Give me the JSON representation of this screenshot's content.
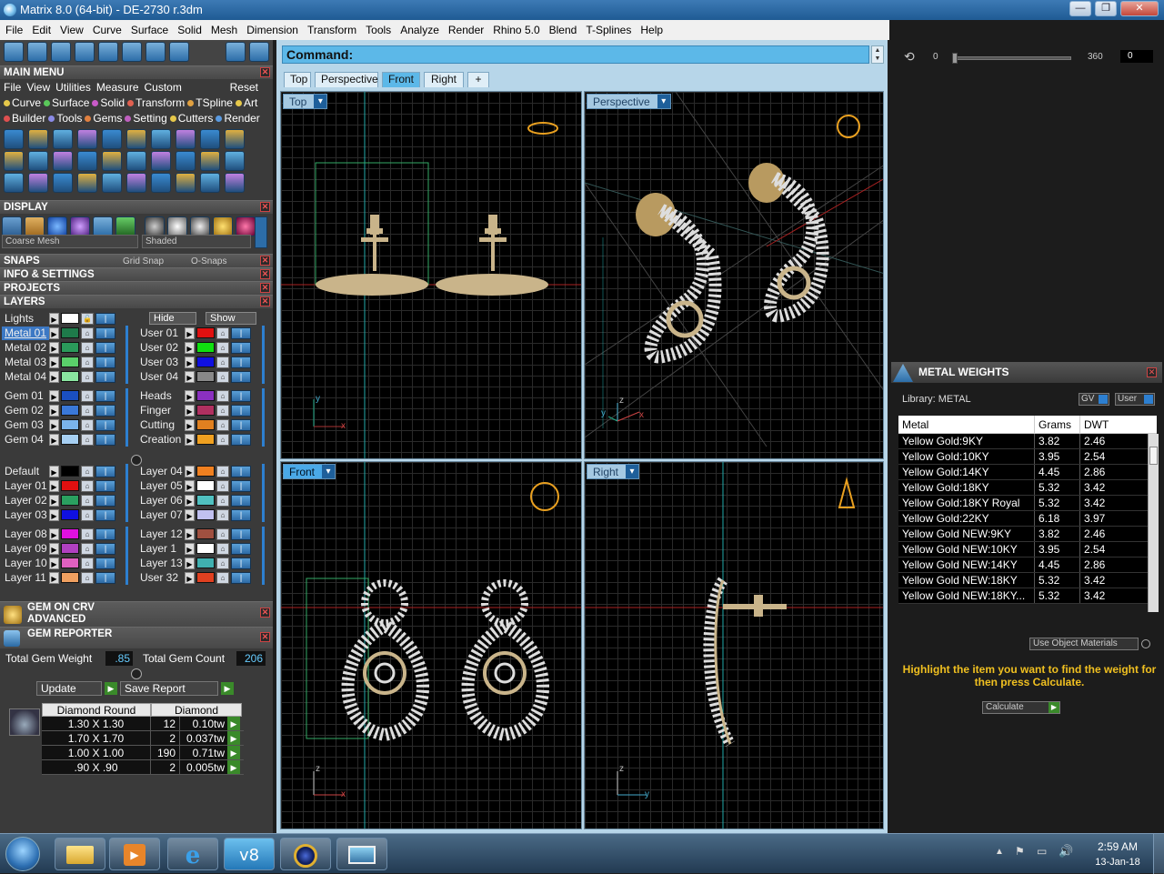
{
  "title": "Matrix 8.0 (64-bit) - DE-2730 r.3dm",
  "window_controls": [
    "—",
    "❐",
    "✕"
  ],
  "menu": [
    "File",
    "Edit",
    "View",
    "Curve",
    "Surface",
    "Solid",
    "Mesh",
    "Dimension",
    "Transform",
    "Tools",
    "Analyze",
    "Render",
    "Rhino 5.0",
    "Blend",
    "T-Splines",
    "Help"
  ],
  "left": {
    "main_menu_title": "MAIN MENU",
    "main_menu_row1": [
      "File",
      "View",
      "Utilities",
      "Measure",
      "Custom"
    ],
    "reset": "Reset",
    "cat_row1": [
      {
        "label": "Curve",
        "color": "#e6c84a"
      },
      {
        "label": "Surface",
        "color": "#5ac85a"
      },
      {
        "label": "Solid",
        "color": "#c85ac8"
      },
      {
        "label": "Transform",
        "color": "#e06050"
      },
      {
        "label": "TSpline",
        "color": "#e0a040"
      },
      {
        "label": "Art",
        "color": "#e6c84a"
      }
    ],
    "cat_row2": [
      {
        "label": "Builder",
        "color": "#e05050"
      },
      {
        "label": "Tools",
        "color": "#8a8ae6"
      },
      {
        "label": "Gems",
        "color": "#e08040"
      },
      {
        "label": "Setting",
        "color": "#c060c0"
      },
      {
        "label": "Cutters",
        "color": "#e6c84a"
      },
      {
        "label": "Render",
        "color": "#5a9ae0"
      }
    ],
    "display_title": "DISPLAY",
    "mesh_select": "Coarse Mesh",
    "shade_select": "Shaded",
    "snaps_title": "SNAPS",
    "grid_snap": "Grid Snap",
    "o_snaps": "O-Snaps",
    "info_title": "INFO & SETTINGS",
    "projects_title": "PROJECTS",
    "layers_title": "LAYERS",
    "lights": "Lights",
    "hide": "Hide",
    "show": "Show",
    "layers_left": [
      {
        "name": "Metal 01",
        "color": "#1e7a4a",
        "selected": true
      },
      {
        "name": "Metal 02",
        "color": "#2a9a5a"
      },
      {
        "name": "Metal 03",
        "color": "#5acf6a"
      },
      {
        "name": "Metal 04",
        "color": "#8ae6a0"
      },
      {
        "name": "Gem 01",
        "color": "#1a4fc0"
      },
      {
        "name": "Gem 02",
        "color": "#3a78d8"
      },
      {
        "name": "Gem 03",
        "color": "#7ab4ec"
      },
      {
        "name": "Gem 04",
        "color": "#a6cff2"
      },
      {
        "name": "Default",
        "color": "#000000"
      },
      {
        "name": "Layer 01",
        "color": "#e01010"
      },
      {
        "name": "Layer 02",
        "color": "#2aa060"
      },
      {
        "name": "Layer 03",
        "color": "#1010e0"
      },
      {
        "name": "Layer 08",
        "color": "#e010e0"
      },
      {
        "name": "Layer 09",
        "color": "#b040c0"
      },
      {
        "name": "Layer 10",
        "color": "#e060c0"
      },
      {
        "name": "Layer 11",
        "color": "#f0a060"
      }
    ],
    "layers_right": [
      {
        "name": "User 01",
        "color": "#e01010"
      },
      {
        "name": "User 02",
        "color": "#10e010"
      },
      {
        "name": "User 03",
        "color": "#1010e0"
      },
      {
        "name": "User 04",
        "color": "#888888"
      },
      {
        "name": "Heads",
        "color": "#8a30c0"
      },
      {
        "name": "Finger",
        "color": "#b03060"
      },
      {
        "name": "Cutting",
        "color": "#e08020"
      },
      {
        "name": "Creation",
        "color": "#f0a020"
      },
      {
        "name": "Layer 04",
        "color": "#f08020"
      },
      {
        "name": "Layer 05",
        "color": "#ffffff"
      },
      {
        "name": "Layer 06",
        "color": "#50c0c0"
      },
      {
        "name": "Layer 07",
        "color": "#c0c0f0"
      },
      {
        "name": "Layer 12",
        "color": "#a05040"
      },
      {
        "name": "Layer 1",
        "color": "#ffffff"
      },
      {
        "name": "Layer 13",
        "color": "#40b0b0"
      },
      {
        "name": "User 32",
        "color": "#e04020"
      }
    ],
    "gem_on_crv": "GEM ON CRV",
    "advanced": "ADVANCED",
    "gem_reporter": "GEM REPORTER",
    "total_weight_label": "Total Gem Weight",
    "total_weight": ".85",
    "total_count_label": "Total Gem Count",
    "total_count": "206",
    "update": "Update",
    "save_report": "Save Report",
    "gem_table_head": [
      "Diamond Round",
      "Diamond"
    ],
    "gem_rows": [
      {
        "size": "1.30 X 1.30",
        "count": "12",
        "tw": "0.10tw"
      },
      {
        "size": "1.70 X 1.70",
        "count": "2",
        "tw": "0.037tw"
      },
      {
        "size": "1.00 X 1.00",
        "count": "190",
        "tw": "0.71tw"
      },
      {
        "size": ".90 X .90",
        "count": "2",
        "tw": "0.005tw"
      }
    ]
  },
  "command": {
    "label": "Command:"
  },
  "view_tabs": [
    "Top",
    "Perspective",
    "Front",
    "Right",
    "+"
  ],
  "active_tab": "Front",
  "viewports": {
    "top": "Top",
    "perspective": "Perspective",
    "front": "Front",
    "right": "Right"
  },
  "right": {
    "slider_min": "0",
    "slider_max": "360",
    "slider_value": "0",
    "mw_title": "METAL WEIGHTS",
    "library": "Library: METAL",
    "gv": "GV",
    "user": "User",
    "headers": [
      "Metal",
      "Grams",
      "DWT"
    ],
    "rows": [
      [
        "Yellow Gold:9KY",
        "3.82",
        "2.46"
      ],
      [
        "Yellow Gold:10KY",
        "3.95",
        "2.54"
      ],
      [
        "Yellow Gold:14KY",
        "4.45",
        "2.86"
      ],
      [
        "Yellow Gold:18KY",
        "5.32",
        "3.42"
      ],
      [
        "Yellow Gold:18KY Royal",
        "5.32",
        "3.42"
      ],
      [
        "Yellow Gold:22KY",
        "6.18",
        "3.97"
      ],
      [
        "Yellow Gold NEW:9KY",
        "3.82",
        "2.46"
      ],
      [
        "Yellow Gold NEW:10KY",
        "3.95",
        "2.54"
      ],
      [
        "Yellow Gold NEW:14KY",
        "4.45",
        "2.86"
      ],
      [
        "Yellow Gold NEW:18KY",
        "5.32",
        "3.42"
      ],
      [
        "Yellow Gold NEW:18KY...",
        "5.32",
        "3.42"
      ]
    ],
    "use_object_materials": "Use Object Materials",
    "hint": "Highlight the item you want to find the weight for then press Calculate.",
    "calculate": "Calculate"
  },
  "taskbar": {
    "time": "2:59 AM",
    "date": "13-Jan-18"
  }
}
